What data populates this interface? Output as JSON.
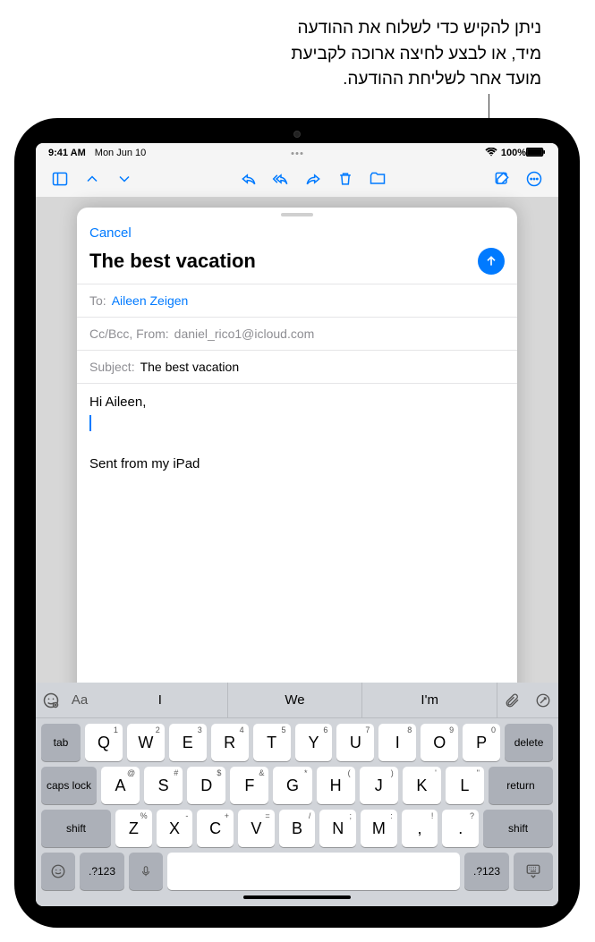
{
  "callout": {
    "line1": "ניתן להקיש כדי לשלוח את ההודעה",
    "line2": "מיד, או לבצע לחיצה ארוכה לקביעת",
    "line3": "מועד אחר לשליחת ההודעה."
  },
  "status": {
    "time": "9:41 AM",
    "date": "Mon Jun 10",
    "battery": "100%"
  },
  "compose": {
    "cancel": "Cancel",
    "title": "The best vacation",
    "to_label": "To:",
    "to_value": "Aileen Zeigen",
    "ccbcc_label": "Cc/Bcc, From:",
    "ccbcc_value": "daniel_rico1@icloud.com",
    "subject_label": "Subject:",
    "subject_value": "The best vacation",
    "body_greeting": "Hi Aileen,",
    "body_signature": "Sent from my iPad"
  },
  "keyboard": {
    "aa": "Aa",
    "suggestions": [
      "I",
      "We",
      "I'm"
    ],
    "row1_letters": [
      "Q",
      "W",
      "E",
      "R",
      "T",
      "Y",
      "U",
      "I",
      "O",
      "P"
    ],
    "row1_subs": [
      "1",
      "2",
      "3",
      "4",
      "5",
      "6",
      "7",
      "8",
      "9",
      "0"
    ],
    "row2_letters": [
      "A",
      "S",
      "D",
      "F",
      "G",
      "H",
      "J",
      "K",
      "L"
    ],
    "row2_subs": [
      "@",
      "#",
      "$",
      "&",
      "*",
      "(",
      ")",
      "'",
      "\""
    ],
    "row3_letters": [
      "Z",
      "X",
      "C",
      "V",
      "B",
      "N",
      "M"
    ],
    "row3_subs": [
      "%",
      "-",
      "+",
      "=",
      "/",
      ";",
      ":"
    ],
    "comma": ",",
    "comma_sub": "!",
    "period": ".",
    "period_sub": "?",
    "tab": "tab",
    "delete": "delete",
    "caps": "caps lock",
    "return": "return",
    "shift": "shift",
    "numkey": ".?123"
  }
}
